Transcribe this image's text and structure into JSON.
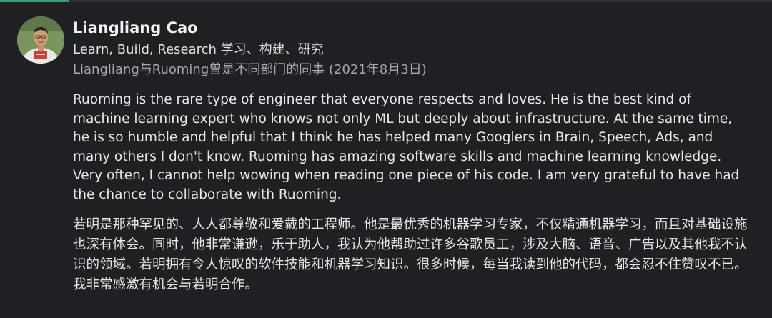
{
  "recommendation": {
    "author_name": "Liangliang Cao",
    "author_headline": "Learn, Build, Research  学习、构建、研究",
    "relationship": "Liangliang与Ruoming曾是不同部门的同事 (2021年8月3日)",
    "text_en": "Ruoming is the rare type of engineer that everyone respects and loves. He is the best kind of machine learning expert who knows not only ML but deeply about infrastructure. At the same time, he is so humble and helpful that I think he has helped many Googlers in Brain, Speech, Ads, and many others I don't know. Ruoming has amazing software skills and machine learning knowledge. Very often, I cannot help wowing when reading one piece of his code. I am very grateful to have had the chance to collaborate with Ruoming.",
    "text_zh": "若明是那种罕见的、人人都尊敬和爱戴的工程师。他是最优秀的机器学习专家，不仅精通机器学习，而且对基础设施也深有体会。同时，他非常谦逊，乐于助人，我认为他帮助过许多谷歌员工，涉及大脑、语音、广告以及其他我不认识的领域。若明拥有令人惊叹的软件技能和机器学习知识。很多时候，每当我读到他的代码，都会忍不住赞叹不已。我非常感激有机会与若明合作。"
  },
  "colors": {
    "background": "#1e2023",
    "active_tab": "#3a9c7a",
    "primary_text": "#e8e8e8",
    "secondary_text": "#a7a9ac"
  }
}
